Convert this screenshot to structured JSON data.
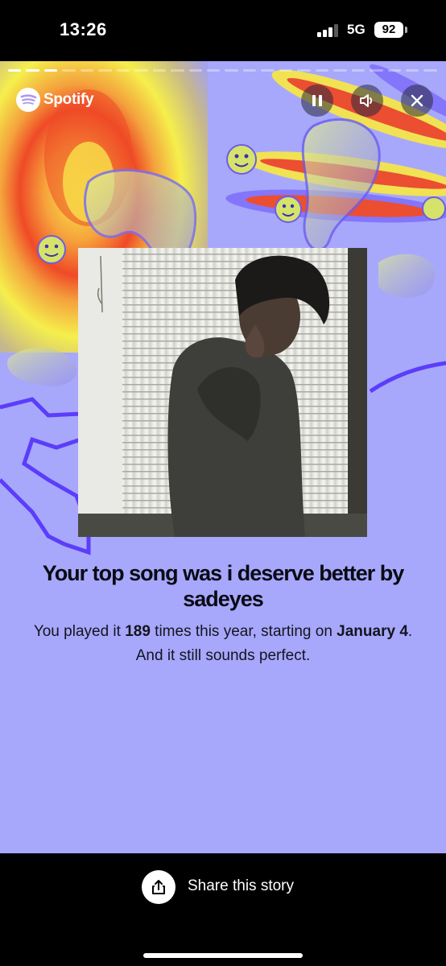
{
  "status_bar": {
    "time": "13:26",
    "network": "5G",
    "battery": "92"
  },
  "story": {
    "brand": "Spotify",
    "progress": {
      "segments": 24,
      "completed": 3
    },
    "controls": {
      "pause": "pause-icon",
      "sound": "speaker-icon",
      "close": "close-icon"
    },
    "title": "Your top song was i deserve better by sadeyes",
    "body": {
      "part1": "You played it ",
      "plays": "189",
      "part2": " times this year, starting on ",
      "date": "January 4",
      "part3": ". And it still sounds perfect."
    },
    "colors": {
      "background": "#a7a8fb",
      "accent": "#5b3dfa"
    }
  },
  "share": {
    "label": "Share this story",
    "icon": "share-icon"
  }
}
